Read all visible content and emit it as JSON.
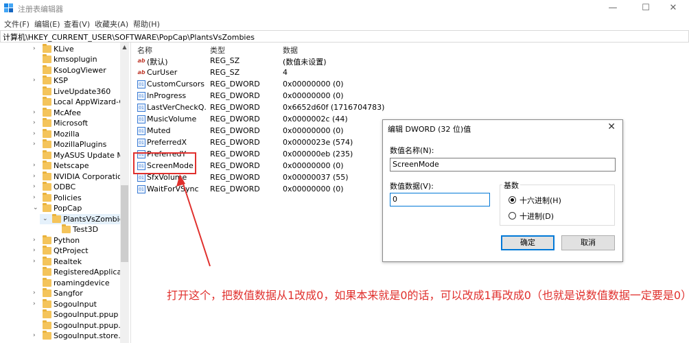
{
  "window": {
    "title": "注册表编辑器",
    "minimize": "—",
    "maximize": "☐",
    "close": "✕"
  },
  "menu": [
    "文件(F)",
    "编辑(E)",
    "查看(V)",
    "收藏夹(A)",
    "帮助(H)"
  ],
  "address": "计算机\\HKEY_CURRENT_USER\\SOFTWARE\\PopCap\\PlantsVsZombies",
  "tree": [
    {
      "label": "KLive",
      "chevron": "›"
    },
    {
      "label": "kmsoplugin",
      "chevron": ""
    },
    {
      "label": "KsoLogViewer",
      "chevron": ""
    },
    {
      "label": "KSP",
      "chevron": "›"
    },
    {
      "label": "LiveUpdate360",
      "chevron": ""
    },
    {
      "label": "Local AppWizard-G",
      "chevron": ""
    },
    {
      "label": "McAfee",
      "chevron": "›"
    },
    {
      "label": "Microsoft",
      "chevron": "›"
    },
    {
      "label": "Mozilla",
      "chevron": "›"
    },
    {
      "label": "MozillaPlugins",
      "chevron": "›"
    },
    {
      "label": "MyASUS Update M",
      "chevron": ""
    },
    {
      "label": "Netscape",
      "chevron": "›"
    },
    {
      "label": "NVIDIA Corporatio",
      "chevron": "›"
    },
    {
      "label": "ODBC",
      "chevron": "›"
    },
    {
      "label": "Policies",
      "chevron": "›"
    },
    {
      "label": "PopCap",
      "chevron": "⌄"
    },
    {
      "label": "PlantsVsZombie",
      "chevron": "⌄"
    },
    {
      "label": "Test3D",
      "chevron": ""
    },
    {
      "label": "Python",
      "chevron": "›"
    },
    {
      "label": "QtProject",
      "chevron": "›"
    },
    {
      "label": "Realtek",
      "chevron": "›"
    },
    {
      "label": "RegisteredApplica",
      "chevron": ""
    },
    {
      "label": "roamingdevice",
      "chevron": ""
    },
    {
      "label": "Sangfor",
      "chevron": "›"
    },
    {
      "label": "SogouInput",
      "chevron": "›"
    },
    {
      "label": "SogouInput.ppup",
      "chevron": ""
    },
    {
      "label": "SogouInput.ppup.u",
      "chevron": ""
    },
    {
      "label": "SogouInput.store.u",
      "chevron": "›"
    }
  ],
  "columns": {
    "name": "名称",
    "type": "类型",
    "data": "数据"
  },
  "values": [
    {
      "icon": "ab",
      "name": "(默认)",
      "type": "REG_SZ",
      "data": "(数值未设置)"
    },
    {
      "icon": "ab",
      "name": "CurUser",
      "type": "REG_SZ",
      "data": "4"
    },
    {
      "icon": "dword",
      "name": "CustomCursors",
      "type": "REG_DWORD",
      "data": "0x00000000 (0)"
    },
    {
      "icon": "dword",
      "name": "InProgress",
      "type": "REG_DWORD",
      "data": "0x00000000 (0)"
    },
    {
      "icon": "dword",
      "name": "LastVerCheckQ...",
      "type": "REG_DWORD",
      "data": "0x6652d60f (1716704783)"
    },
    {
      "icon": "dword",
      "name": "MusicVolume",
      "type": "REG_DWORD",
      "data": "0x0000002c (44)"
    },
    {
      "icon": "dword",
      "name": "Muted",
      "type": "REG_DWORD",
      "data": "0x00000000 (0)"
    },
    {
      "icon": "dword",
      "name": "PreferredX",
      "type": "REG_DWORD",
      "data": "0x0000023e (574)"
    },
    {
      "icon": "dword",
      "name": "PreferredY",
      "type": "REG_DWORD",
      "data": "0x000000eb (235)"
    },
    {
      "icon": "dword",
      "name": "ScreenMode",
      "type": "REG_DWORD",
      "data": "0x00000000 (0)"
    },
    {
      "icon": "dword",
      "name": "SfxVolume",
      "type": "REG_DWORD",
      "data": "0x00000037 (55)"
    },
    {
      "icon": "dword",
      "name": "WaitForVSync",
      "type": "REG_DWORD",
      "data": "0x00000000 (0)"
    }
  ],
  "dialog": {
    "title": "编辑 DWORD (32 位)值",
    "close": "✕",
    "name_label": "数值名称(N):",
    "name_value": "ScreenMode",
    "data_label": "数值数据(V):",
    "data_value": "0",
    "base_label": "基数",
    "hex_label": "十六进制(H)",
    "dec_label": "十进制(D)",
    "ok": "确定",
    "cancel": "取消"
  },
  "annotation": "打开这个，把数值数据从1改成0，如果本来就是0的话，可以改成1再改成0（也就是说数值数据一定要是0）",
  "colors": {
    "annotation": "#e0302d",
    "accent": "#0078d7"
  }
}
